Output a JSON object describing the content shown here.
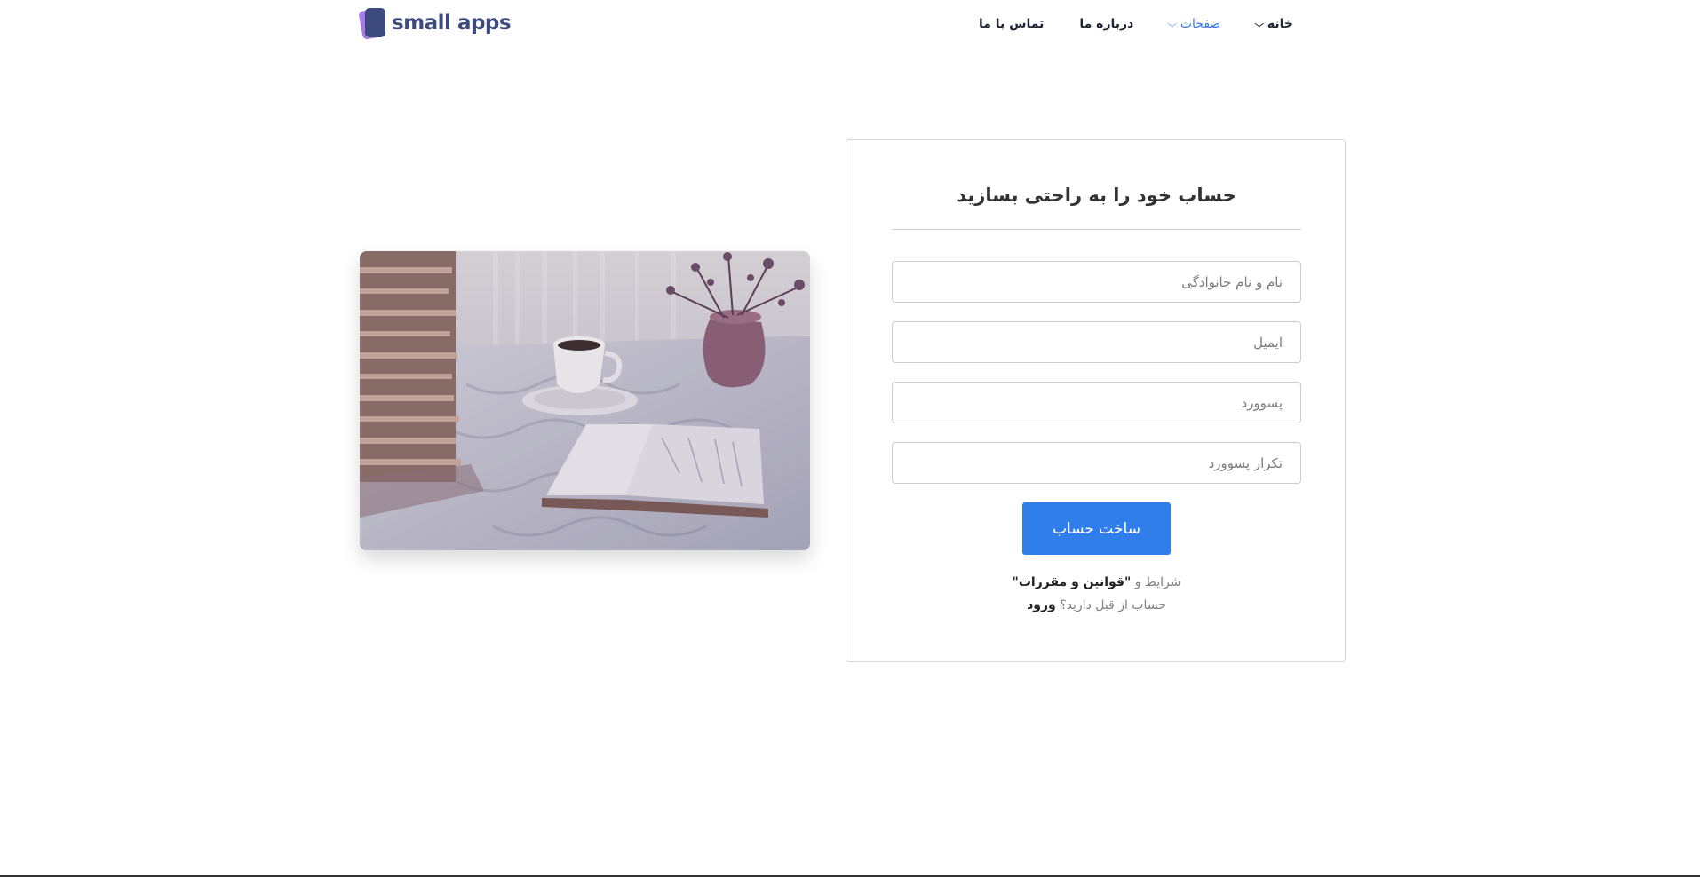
{
  "brand": {
    "name": "small apps"
  },
  "nav": {
    "items": [
      {
        "label": "خانه",
        "has_dropdown": true,
        "active": false
      },
      {
        "label": "صفحات",
        "has_dropdown": true,
        "active": true
      },
      {
        "label": "درباره ما",
        "has_dropdown": false,
        "active": false
      },
      {
        "label": "تماس با ما",
        "has_dropdown": false,
        "active": false
      }
    ],
    "chevron": "⌵"
  },
  "form": {
    "title": "حساب خود را به راحتی بسازید",
    "fields": {
      "fullname_placeholder": "نام و نام خانوادگی",
      "email_placeholder": "ایمیل",
      "password_placeholder": "پسوورد",
      "password_repeat_placeholder": "تکرار پسوورد"
    },
    "submit_label": "ساخت حساب",
    "terms_prefix": "شرایط و ",
    "terms_link": "\"قوانین و مقررات\"",
    "login_prefix": "حساب از قبل دارید؟ ",
    "login_link": "ورود"
  },
  "colors": {
    "accent": "#2f7ee9",
    "brand": "#3d4a7d",
    "brand_secondary": "#a77be6"
  },
  "icons": {
    "logo": "cards-logo-icon",
    "dropdown": "chevron-down-icon"
  }
}
